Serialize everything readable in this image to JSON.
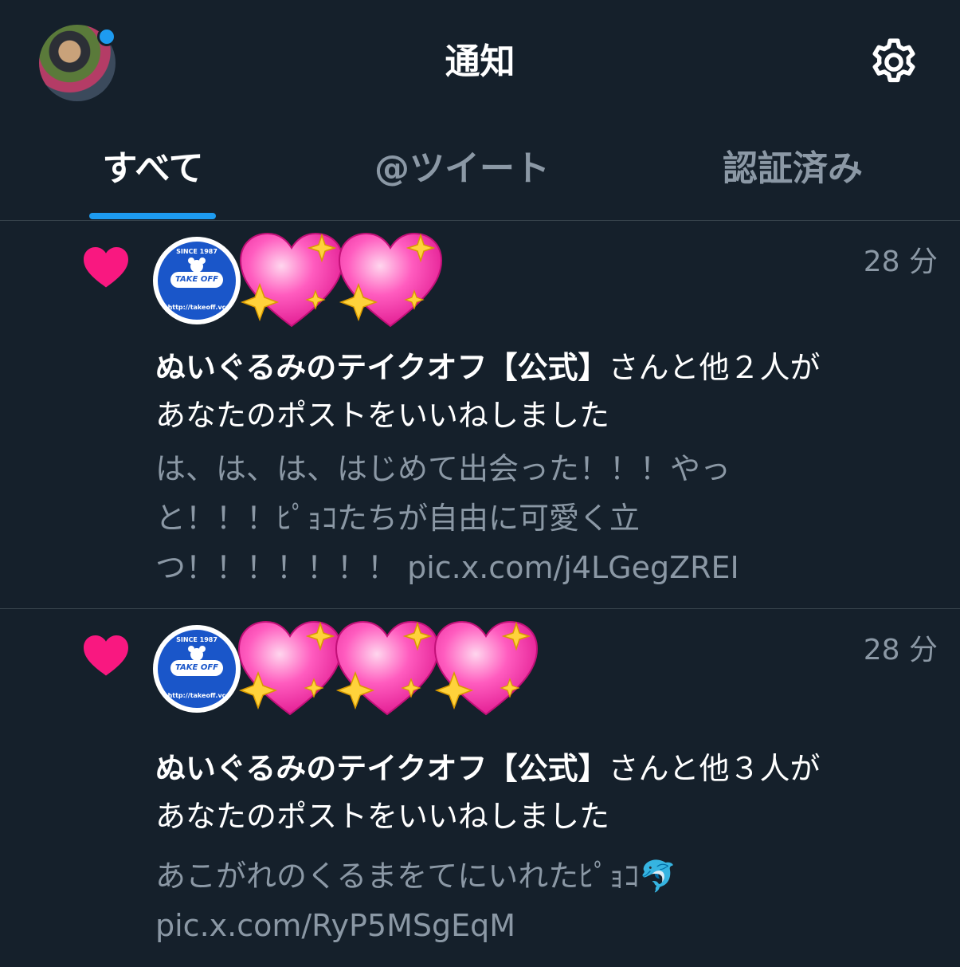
{
  "header": {
    "title": "通知",
    "avatar_icon": "profile-avatar",
    "settings_icon": "gear-icon"
  },
  "tabs": [
    {
      "label": "すべて",
      "active": true
    },
    {
      "label": "@ツイート",
      "active": false
    },
    {
      "label": "認証済み",
      "active": false
    }
  ],
  "notifications": [
    {
      "icon": "heart-icon",
      "actor_name": "ぬいぐるみのテイクオフ【公式】",
      "action_suffix": "さんと他２人が",
      "action_line2": "あなたのポストをいいねしました",
      "time": "28 分",
      "snippet_lines": [
        "は、は、は、はじめて出会った！！！やっ",
        "と！！！ﾋﾟｮｺたちが自由に可愛く立",
        "つ！！！！！！！ pic.x.com/j4LGegZREI"
      ],
      "avatar_logo": {
        "since": "SINCE 1987",
        "name": "TAKE OFF",
        "url": "http://takeoff.vc"
      },
      "extra_avatars": 2
    },
    {
      "icon": "heart-icon",
      "actor_name": "ぬいぐるみのテイクオフ【公式】",
      "action_suffix": "さんと他３人が",
      "action_line2": "あなたのポストをいいねしました",
      "time": "28 分",
      "snippet_lines": [
        "あこがれのくるまをてにいれたﾋﾟｮｺ🐬",
        "pic.x.com/RyP5MSgEqM"
      ],
      "avatar_logo": {
        "since": "SINCE 1987",
        "name": "TAKE OFF",
        "url": "http://takeoff.vc"
      },
      "extra_avatars": 3
    }
  ],
  "colors": {
    "background": "#15202b",
    "accent": "#1d9bf0",
    "like_heart": "#f91880",
    "secondary_text": "#8b98a5"
  }
}
